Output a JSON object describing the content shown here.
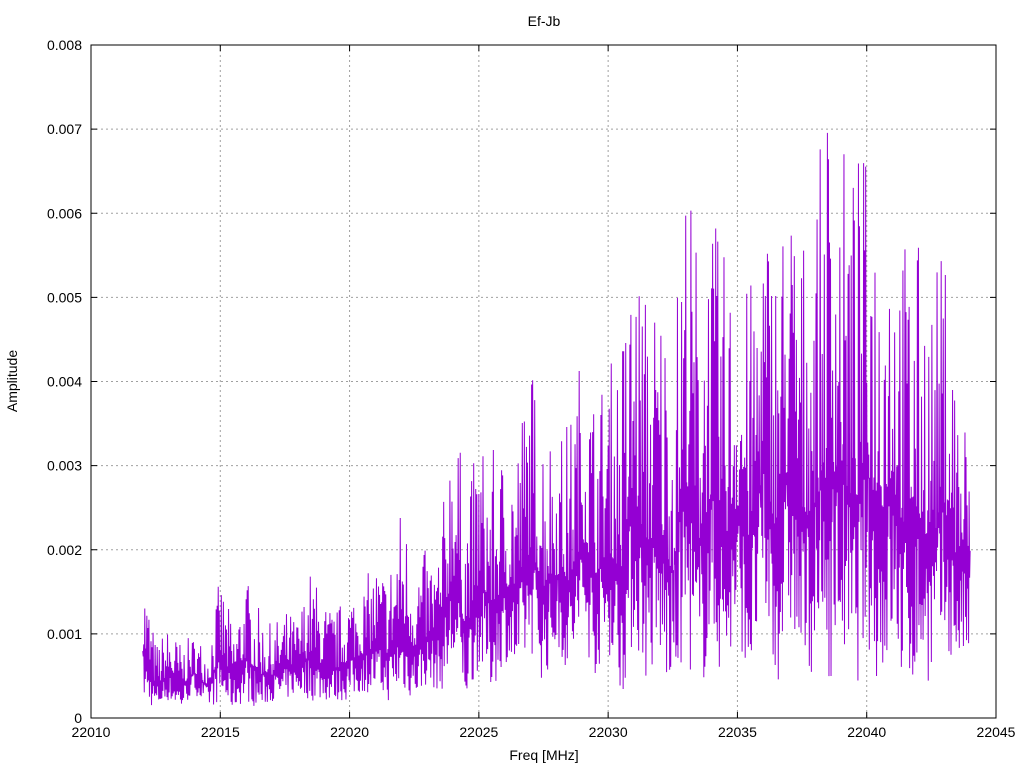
{
  "chart_data": {
    "type": "line",
    "title": "Ef-Jb",
    "xlabel": "Freq [MHz]",
    "ylabel": "Amplitude",
    "xlim": [
      22010,
      22045
    ],
    "ylim": [
      0,
      0.008
    ],
    "xticks": [
      22010,
      22015,
      22020,
      22025,
      22030,
      22035,
      22040,
      22045
    ],
    "yticks": [
      0,
      0.001,
      0.002,
      0.003,
      0.004,
      0.005,
      0.006,
      0.007,
      0.008
    ],
    "xtick_labels": [
      "22010",
      "22015",
      "22020",
      "22025",
      "22030",
      "22035",
      "22040",
      "22045"
    ],
    "ytick_labels": [
      "0",
      "0.001",
      "0.002",
      "0.003",
      "0.004",
      "0.005",
      "0.006",
      "0.007",
      "0.008"
    ],
    "grid": true,
    "line_color": "#9400d3",
    "series": [
      {
        "x": [
          22012.0,
          22012.5,
          22013.0,
          22013.5,
          22014.0,
          22014.5,
          22015.0,
          22015.5,
          22016.0,
          22016.5,
          22017.0,
          22017.5,
          22018.0,
          22018.5,
          22019.0,
          22019.5,
          22020.0,
          22020.5,
          22021.0,
          22021.5,
          22022.0,
          22022.5,
          22023.0,
          22023.5,
          22024.0,
          22024.5,
          22025.0,
          22025.5,
          22026.0,
          22026.5,
          22027.0,
          22027.5,
          22028.0,
          22028.5,
          22029.0,
          22029.5,
          22030.0,
          22030.5,
          22031.0,
          22031.5,
          22032.0,
          22032.5,
          22033.0,
          22033.5,
          22034.0,
          22034.5,
          22035.0,
          22035.5,
          22036.0,
          22036.5,
          22037.0,
          22037.5,
          22038.0,
          22038.5,
          22039.0,
          22039.5,
          22040.0,
          22040.5,
          22041.0,
          22041.5,
          22042.0,
          22042.5,
          22043.0,
          22043.5,
          22044.0
        ],
        "min": [
          0.0002,
          0.0001,
          0.0002,
          0.0001,
          0.0003,
          0.0001,
          0.0002,
          0.0001,
          0.0002,
          0.0001,
          0.0002,
          0.0002,
          0.0003,
          0.0002,
          0.0002,
          0.0002,
          0.0002,
          0.0003,
          0.0003,
          0.0002,
          0.0003,
          0.0002,
          0.0004,
          0.0003,
          0.0005,
          0.0002,
          0.0006,
          0.0003,
          0.0007,
          0.0004,
          0.0008,
          0.0004,
          0.0008,
          0.0005,
          0.0009,
          0.0005,
          0.0008,
          0.0002,
          0.0009,
          0.0004,
          0.0006,
          0.0002,
          0.0008,
          0.0001,
          0.0009,
          0.0003,
          0.001,
          0.0004,
          0.0012,
          0.0003,
          0.0011,
          0.0004,
          0.0006,
          0.0004,
          0.0008,
          0.0002,
          0.0009,
          0.0003,
          0.0008,
          0.0002,
          0.0005,
          0.0004,
          0.0008,
          0.0006,
          0.0007
        ],
        "max": [
          0.0019,
          0.0009,
          0.0011,
          0.0009,
          0.001,
          0.0009,
          0.0017,
          0.0011,
          0.0017,
          0.0013,
          0.0011,
          0.0013,
          0.0012,
          0.0018,
          0.0014,
          0.0013,
          0.0016,
          0.0016,
          0.0019,
          0.0018,
          0.0026,
          0.002,
          0.002,
          0.0021,
          0.004,
          0.0026,
          0.0034,
          0.0032,
          0.0032,
          0.0035,
          0.0043,
          0.0037,
          0.0034,
          0.0036,
          0.0045,
          0.0039,
          0.0042,
          0.0046,
          0.0057,
          0.0051,
          0.0052,
          0.0045,
          0.0067,
          0.0057,
          0.006,
          0.0056,
          0.0052,
          0.0052,
          0.0062,
          0.0058,
          0.0065,
          0.0058,
          0.0062,
          0.0076,
          0.0069,
          0.0067,
          0.0068,
          0.0063,
          0.0064,
          0.0058,
          0.0057,
          0.0052,
          0.0057,
          0.0042,
          0.0035
        ]
      }
    ]
  }
}
